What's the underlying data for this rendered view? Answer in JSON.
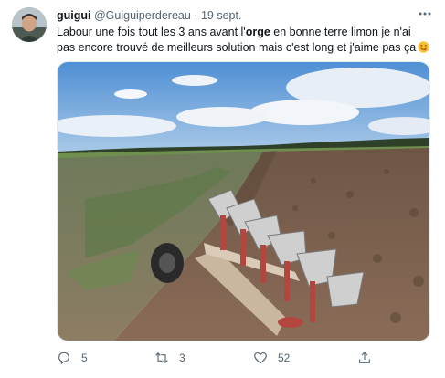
{
  "tweet": {
    "display_name": "guigui",
    "handle": "@Guiguiperdereau",
    "separator": "·",
    "date": "19 sept.",
    "text_before_bold": "Labour une fois tout les 3 ans avant l'",
    "text_bold": "orge",
    "text_after_bold": " en bonne terre limon je n'ai pas encore trouvé de meilleurs solution mais c'est long et j'aime pas ça",
    "emoji": "face-savoring-food-emoji"
  },
  "actions": {
    "reply_count": "5",
    "retweet_count": "3",
    "like_count": "52"
  },
  "icons": {
    "more": "more-dots-icon",
    "reply": "reply-icon",
    "retweet": "retweet-icon",
    "like": "heart-icon",
    "share": "share-icon"
  },
  "colors": {
    "text": "#0f1419",
    "secondary": "#536471",
    "emoji": "#fbc02d"
  }
}
